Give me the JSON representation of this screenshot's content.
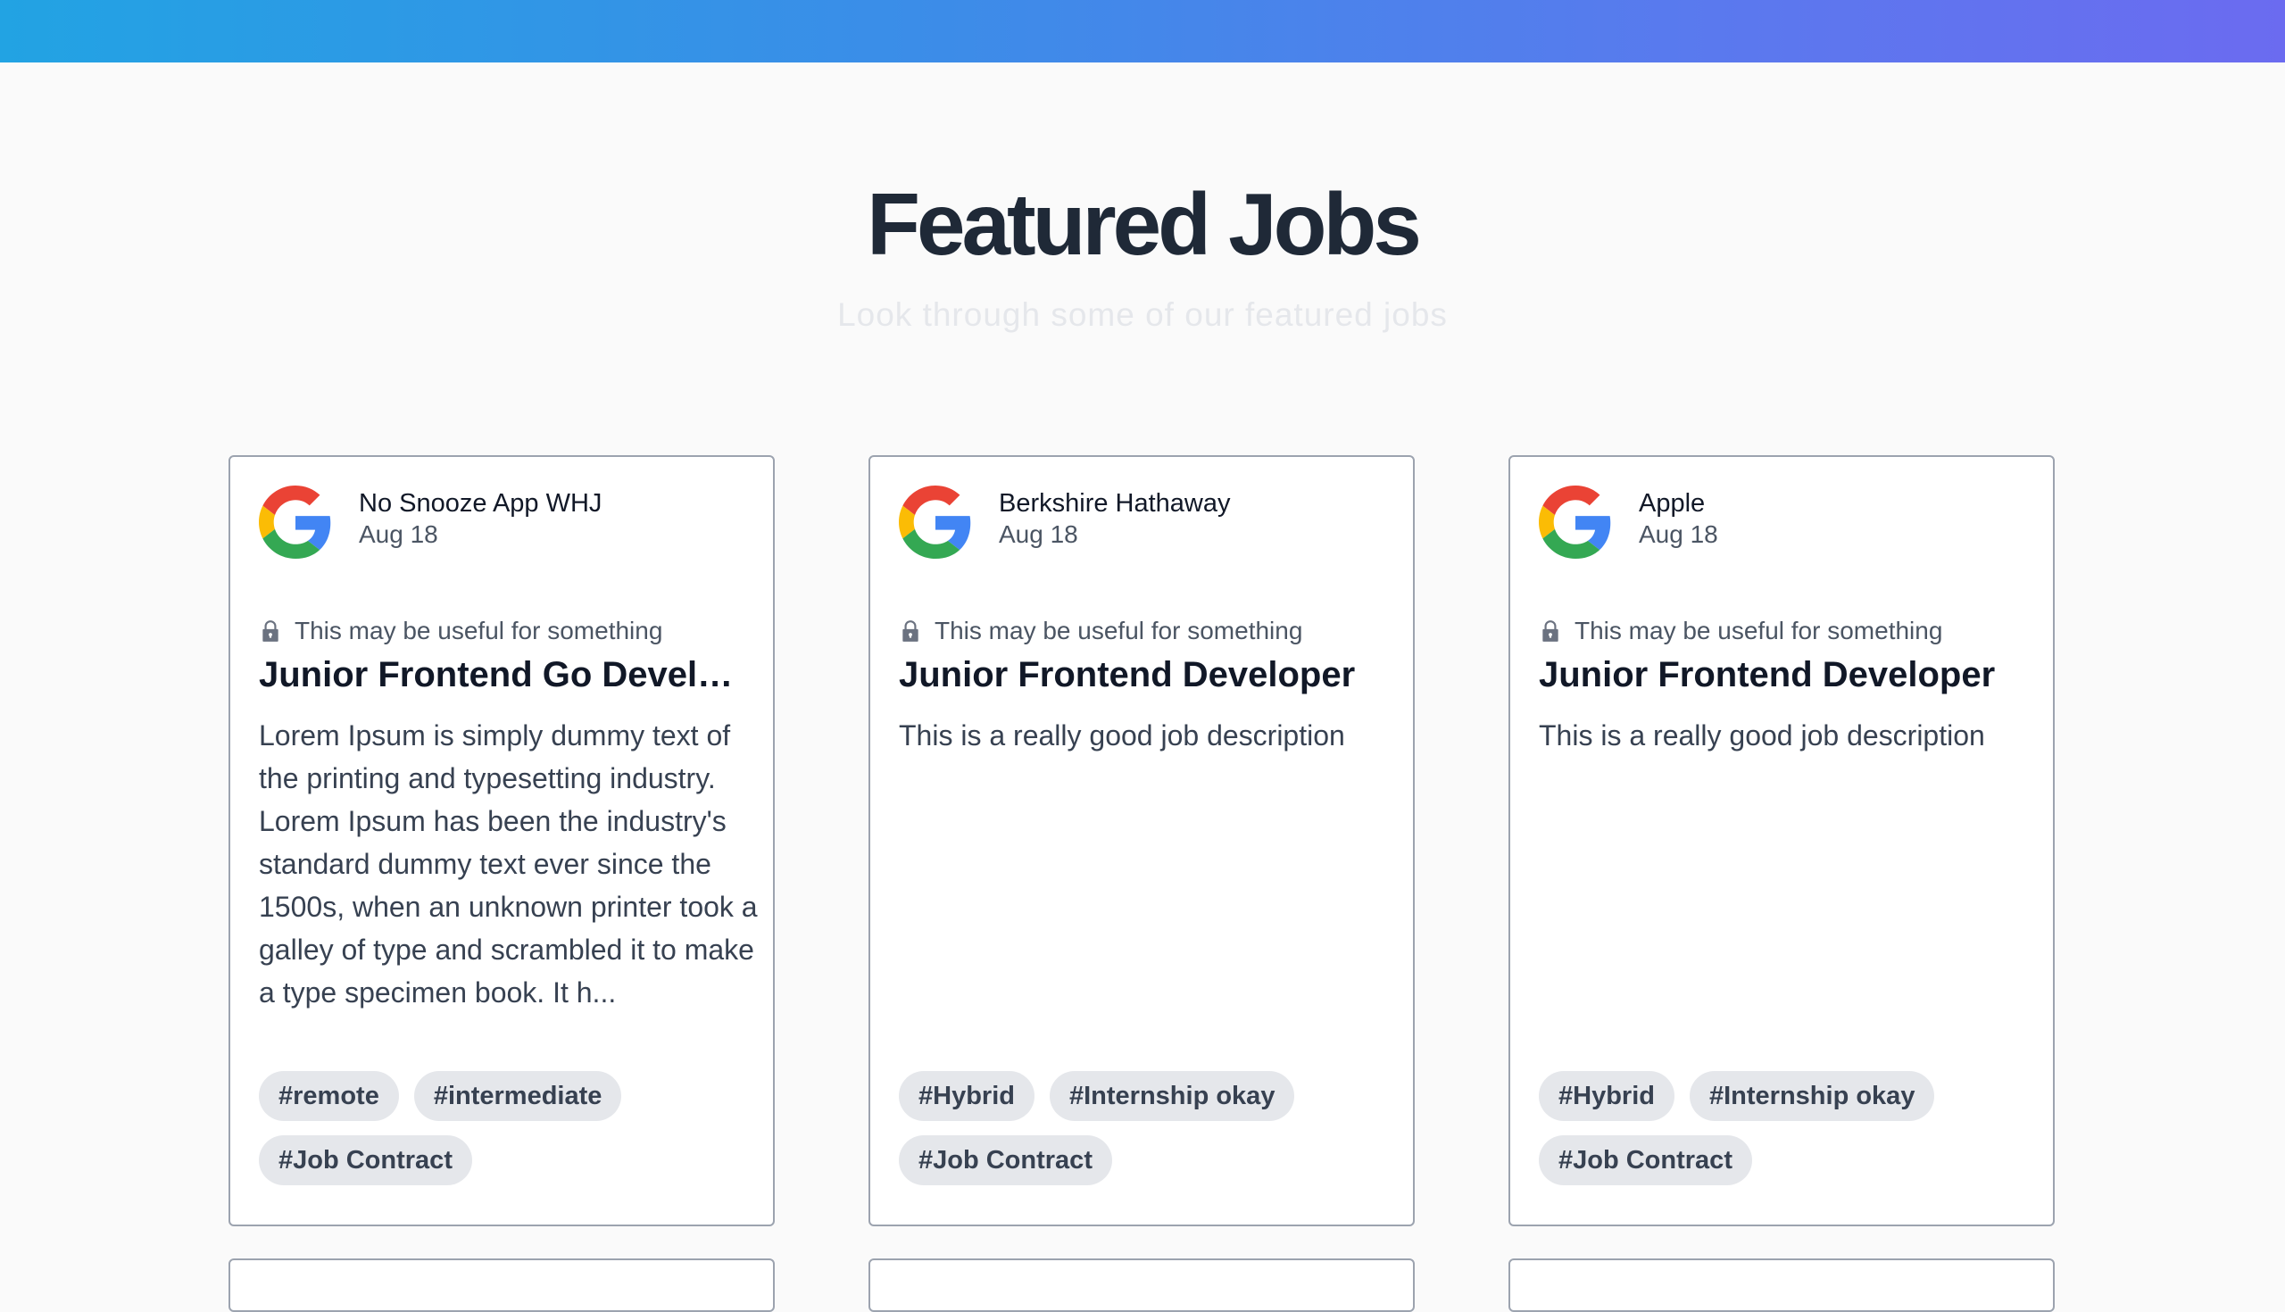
{
  "hero": {
    "title": "Featured Jobs",
    "subtitle": "Look through some of our featured jobs"
  },
  "jobs": [
    {
      "company": "No Snooze App WHJ",
      "date": "Aug 18",
      "note": "This may be useful for something",
      "title": "Junior Frontend Go Developer",
      "description": "Lorem Ipsum is simply dummy text of the printing and typesetting industry. Lorem Ipsum has been the industry's standard dummy text ever since the 1500s, when an unknown printer took a galley of type and scrambled it to make a type specimen book. It h...",
      "tags": [
        "#remote",
        "#intermediate",
        "#Job Contract"
      ]
    },
    {
      "company": "Berkshire Hathaway",
      "date": "Aug 18",
      "note": "This may be useful for something",
      "title": "Junior Frontend Developer",
      "description": "This is a really good job description",
      "tags": [
        "#Hybrid",
        "#Internship okay",
        "#Job Contract"
      ]
    },
    {
      "company": "Apple",
      "date": "Aug 18",
      "note": "This may be useful for something",
      "title": "Junior Frontend Developer",
      "description": "This is a really good job description",
      "tags": [
        "#Hybrid",
        "#Internship okay",
        "#Job Contract"
      ]
    }
  ],
  "icons": {
    "company_logo": "google-logo-icon",
    "note": "lock-icon"
  },
  "colors": {
    "gradient_start": "#22a3e3",
    "gradient_end": "#6b6bf0",
    "tag_background": "#e5e7eb",
    "card_border": "#9ca3af"
  }
}
